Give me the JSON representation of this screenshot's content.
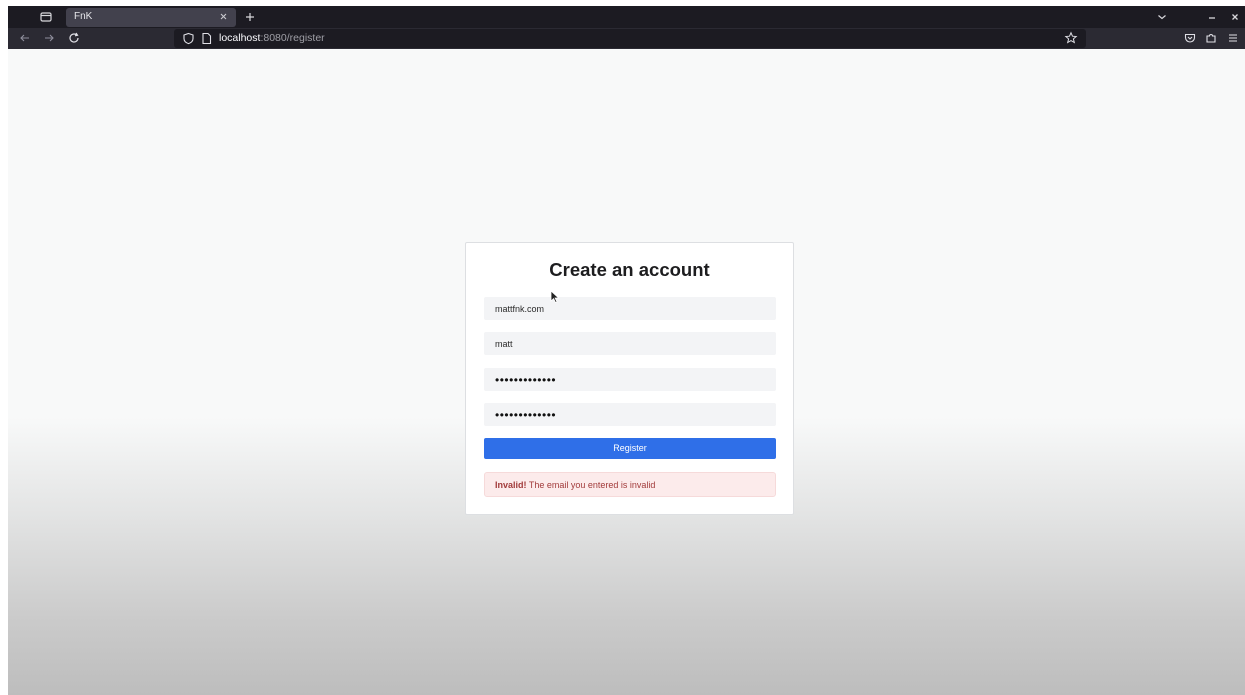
{
  "browser": {
    "tab": {
      "title": "FnK"
    },
    "url": {
      "host": "localhost",
      "rest": ":8080/register"
    },
    "icons": [
      "tab-list-icon",
      "close-icon",
      "plus-icon",
      "chevron-down-icon",
      "minimize-icon",
      "close-icon",
      "back-arrow-icon",
      "forward-arrow-icon",
      "reload-icon",
      "shield-icon",
      "page-icon",
      "star-icon",
      "pocket-icon",
      "extensions-icon",
      "hamburger-menu-icon"
    ]
  },
  "form": {
    "title": "Create an account",
    "email_value": "mattfnk.com",
    "username_value": "matt",
    "password_value": "•••••••••••••",
    "confirm_password_value": "•••••••••••••",
    "submit_label": "Register",
    "error": {
      "strong": "Invalid!",
      "message": " The email you entered is invalid"
    }
  },
  "colors": {
    "chrome_dark": "#1c1b22",
    "toolbar": "#2b2a33",
    "tab_active": "#42414d",
    "button_primary": "#2f6fe8",
    "input_bg": "#f3f4f6",
    "error_bg": "#fcebeb",
    "error_text": "#a23b3b"
  }
}
